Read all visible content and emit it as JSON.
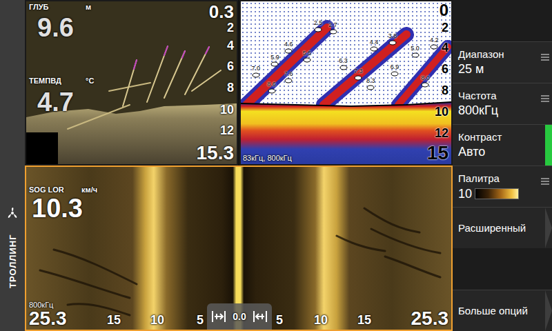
{
  "mode": {
    "label": "ТРОЛЛИНГ"
  },
  "panels": {
    "downscan": {
      "selected": false,
      "depth_label": "ГЛУБ",
      "depth_unit": "м",
      "depth": "9.6",
      "temp_label": "ТЕМПВД",
      "temp_unit": "°С",
      "temp": "4.7",
      "range_top": "0.3",
      "scale": [
        "2",
        "4",
        "6",
        "8",
        "10",
        "12"
      ],
      "range_bottom": "15.3"
    },
    "sonar": {
      "selected": false,
      "scale": [
        "0",
        "2",
        "4",
        "6",
        "8",
        "10",
        "12",
        "15"
      ],
      "frequency": "83кГц, 800кГц",
      "fish": [
        {
          "label": "2.5",
          "time": 36.7,
          "depth": 2.5
        },
        {
          "label": "2.7",
          "time": 43.8,
          "depth": 2.7
        },
        {
          "label": "4.6",
          "time": 22.7,
          "depth": 4.6
        },
        {
          "label": "5.5",
          "time": 31.5,
          "depth": 5.5
        },
        {
          "label": "5.9",
          "time": 16.2,
          "depth": 5.9
        },
        {
          "label": "7.0",
          "time": 7.1,
          "depth": 7.0
        },
        {
          "label": "7.6",
          "time": 22.7,
          "depth": 7.6
        },
        {
          "label": "8.6",
          "time": 14.6,
          "depth": 8.6
        },
        {
          "label": "3.8",
          "time": 72.1,
          "depth": 3.8
        },
        {
          "label": "4.4",
          "time": 63.3,
          "depth": 4.4
        },
        {
          "label": "4.2",
          "time": 91.9,
          "depth": 4.2
        },
        {
          "label": "5.0",
          "time": 82.8,
          "depth": 5.0
        },
        {
          "label": "6.3",
          "time": 48.7,
          "depth": 6.3
        },
        {
          "label": "6.9",
          "time": 73.1,
          "depth": 6.9
        },
        {
          "label": "7.3",
          "time": 55.8,
          "depth": 7.3
        },
        {
          "label": "8.0",
          "time": 87.7,
          "depth": 8.0
        },
        {
          "label": "8.3",
          "time": 61.7,
          "depth": 8.3
        }
      ]
    },
    "sidescan": {
      "selected": true,
      "speed_label": "SOG LOR",
      "speed_unit": "км/ч",
      "speed": "10.3",
      "frequency": "800кГц",
      "scale": [
        "25.3",
        "15",
        "10",
        "5",
        "0.0",
        "5",
        "10",
        "15",
        "25.3"
      ]
    }
  },
  "menu": {
    "items": [
      {
        "label": "Диапазон",
        "value": "25 м",
        "kind": "list",
        "selected": false
      },
      {
        "label": "Частота",
        "value": "800кГц",
        "kind": "list",
        "selected": false
      },
      {
        "label": "Контраст",
        "value": "Авто",
        "kind": "value",
        "selected": true
      },
      {
        "label": "Палитра",
        "value": "10",
        "kind": "palette",
        "selected": false
      },
      {
        "label": "Расширенный",
        "value": "",
        "kind": "submenu",
        "selected": false
      },
      {
        "label": "Больше опций",
        "value": "",
        "kind": "submenu",
        "selected": false
      }
    ]
  }
}
